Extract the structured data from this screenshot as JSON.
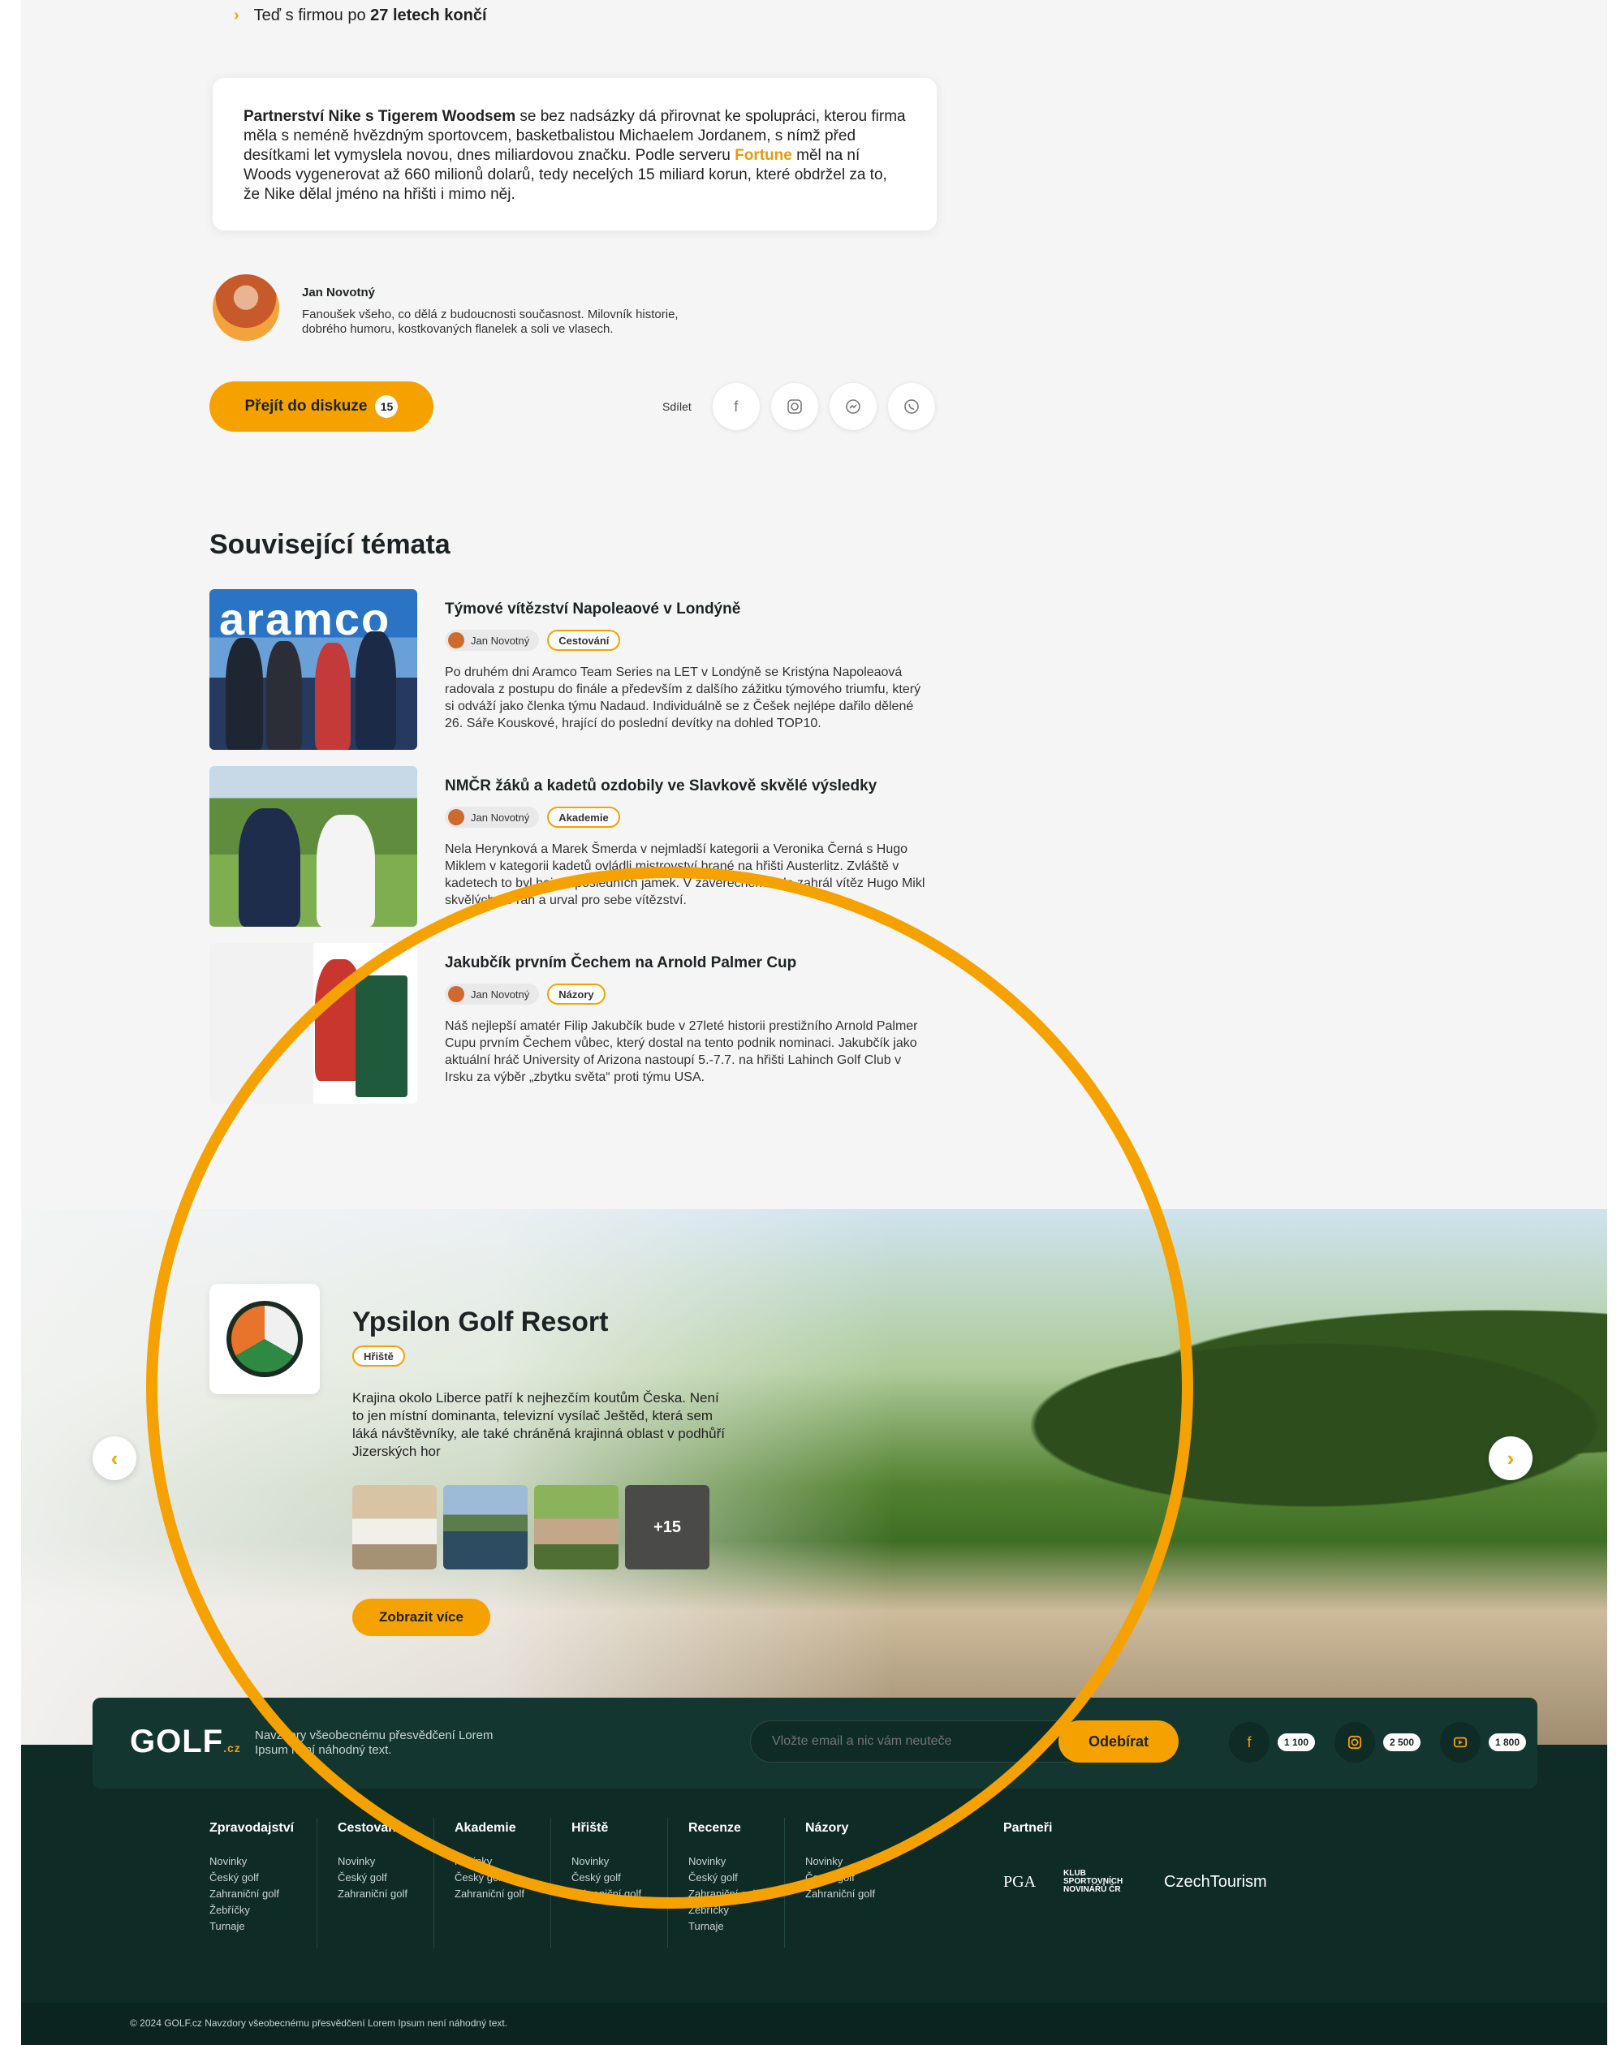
{
  "article": {
    "bullet": {
      "pre": "Teď s firmou po",
      "bold": "27 letech končí"
    },
    "quote": {
      "bold": "Partnerství Nike s Tigerem Woodsem",
      "t1": " se bez nadsázky dá přirovnat ke  spolupráci, kterou firma měla s neméně hvězdným sportovcem,  basketbalistou Michaelem Jordanem, s nímž před desítkami let vymyslela novou, dnes miliardovou značku. Podle serveru ",
      "link": "Fortune",
      "t2": " měl  na ní Woods vygenerovat až 660 milionů dolarů, tedy necelých 15 miliard korun, které obdržel za to, že Nike dělal jméno na hřišti i mimo něj."
    },
    "author": {
      "name": "Jan Novotný",
      "bio": "Fanoušek všeho, co dělá z budoucnosti současnost. Milovník historie, dobrého humoru, kostkovaných flanelek a soli ve vlasech."
    },
    "discuss": {
      "label": "Přejít do diskuze",
      "count": "15"
    },
    "share": {
      "label": "Sdílet",
      "icons": [
        "facebook-icon",
        "instagram-icon",
        "messenger-icon",
        "whatsapp-icon"
      ]
    }
  },
  "related": {
    "title": "Související témata",
    "items": [
      {
        "title": "Týmové vítězství Napoleaové v Londýně",
        "author": "Jan Novotný",
        "tag": "Cestování",
        "thumb_text": "aramco",
        "text": "Po druhém dni Aramco Team Series na LET v Londýně se Kristýna Napoleaová radovala z postupu do finále a především z dalšího zážitku týmového triumfu, který si odváží jako členka týmu Nadaud. Individuálně se z Češek nejlépe dařilo dělené 26. Sáře Kouskové, hrající do poslední devítky na dohled TOP10."
      },
      {
        "title": "NMČR žáků a kadetů ozdobily ve Slavkově skvělé výsledky",
        "author": "Jan Novotný",
        "tag": "Akademie",
        "text": "Nela Herynková a Marek Šmerda v nejmladší kategorii a Veronika Černá s Hugo Miklem v kategorii kadetů ovládli mistrovství hrané na hřišti Austerlitz. Zvláště v kadetech to byl boj do posledních jamek. V závěrečném kole zahrál vítěz Hugo Mikl skvělých 65 ran a urval pro sebe vítězství."
      },
      {
        "title": "Jakubčík prvním Čechem na Arnold Palmer Cup",
        "author": "Jan Novotný",
        "tag": "Názory",
        "text": "Náš nejlepší amatér Filip Jakubčík bude v 27leté historii prestižního Arnold Palmer Cupu prvním Čechem vůbec, který dostal na tento podnik nominaci. Jakubčík jako aktuální hráč University of Arizona nastoupí 5.-7.7. na hřišti Lahinch Golf Club v Irsku za výběr „zbytku světa“ proti týmu USA."
      }
    ]
  },
  "resort": {
    "name": "Ypsilon Golf Resort",
    "tag": "Hřiště",
    "desc": "Krajina okolo Liberce patří k nejhezčím koutům Česka. Není to jen místní  dominanta, televizní vysílač Ještěd, která sem láká návštěvníky, ale  také chráněná krajinná oblast v podhůří Jizerských hor",
    "more_photos": "+15",
    "button": "Zobrazit více"
  },
  "newsletter": {
    "brand": "GOLF",
    "brand_suffix": ".cz",
    "slogan": "Navzdory všeobecnému přesvědčení Lorem Ipsum není náhodný text.",
    "placeholder": "Vložte email a nic vám neuteče",
    "button": "Odebírat",
    "social": [
      {
        "icon": "facebook-icon",
        "count": "1 100"
      },
      {
        "icon": "instagram-icon",
        "count": "2 500"
      },
      {
        "icon": "youtube-icon",
        "count": "1 800"
      }
    ]
  },
  "footer": {
    "columns": [
      {
        "heading": "Zpravodajství",
        "links": [
          "Novinky",
          "Český golf",
          "Zahraniční golf",
          "Žebříčky",
          "Turnaje"
        ]
      },
      {
        "heading": "Cestování",
        "links": [
          "Novinky",
          "Český golf",
          "Zahraniční golf"
        ]
      },
      {
        "heading": "Akademie",
        "links": [
          "Novinky",
          "Český golf",
          "Zahraniční golf"
        ]
      },
      {
        "heading": "Hřiště",
        "links": [
          "Novinky",
          "Český golf",
          "Zahraniční golf"
        ]
      },
      {
        "heading": "Recenze",
        "links": [
          "Novinky",
          "Český golf",
          "Zahraniční golf",
          "Žebříčky",
          "Turnaje"
        ]
      },
      {
        "heading": "Názory",
        "links": [
          "Novinky",
          "Český golf",
          "Zahraniční golf"
        ]
      }
    ],
    "partners": {
      "heading": "Partneři",
      "logos": [
        "PGA",
        "KLUB SPORTOVNÍCH NOVINÁŘŮ ČR",
        "CzechTourism"
      ]
    },
    "copyright": "© 2024 GOLF.cz  Navzdory všeobecnému přesvědčení Lorem Ipsum není náhodný text."
  },
  "colors": {
    "accent": "#f5a200",
    "footer_bg": "#0f2b26",
    "annotation_circle": "#f5a200"
  }
}
